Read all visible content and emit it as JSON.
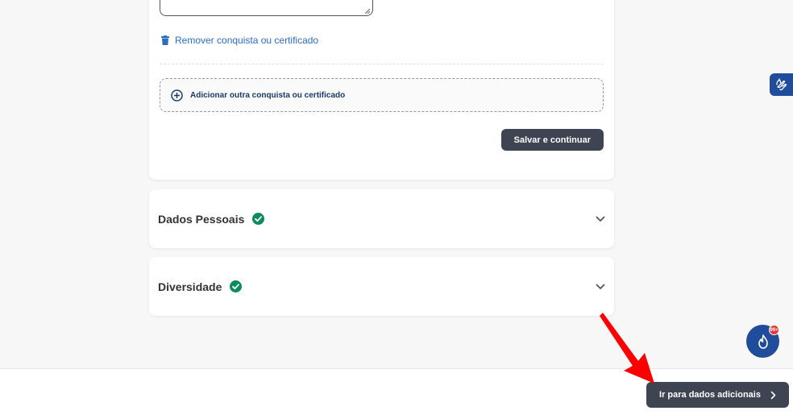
{
  "achievement": {
    "remove_label": "Remover conquista ou certificado",
    "add_label": "Adicionar outra conquista ou certificado",
    "save_label": "Salvar e continuar"
  },
  "sections": [
    {
      "title": "Dados Pessoais",
      "status": "complete"
    },
    {
      "title": "Diversidade",
      "status": "complete"
    }
  ],
  "footer": {
    "next_label": "Ir para dados adicionais"
  },
  "notification": {
    "badge": "99+"
  },
  "colors": {
    "primary_dark": "#3e4452",
    "link": "#2b6ec2",
    "success": "#0e8a5f",
    "brand_blue": "#1f4d9c",
    "badge_red": "#e53935",
    "annotation_red": "#ff0000"
  }
}
